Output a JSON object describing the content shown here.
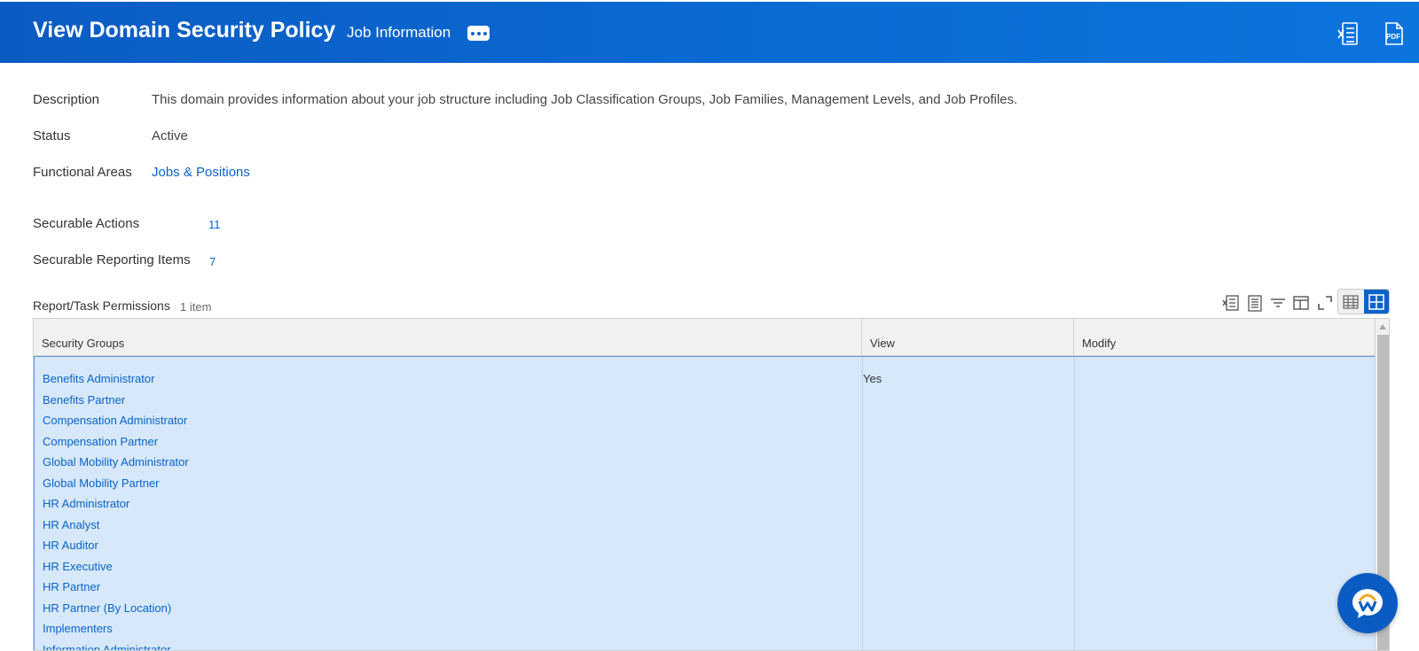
{
  "header": {
    "title": "View Domain Security Policy",
    "subtitle": "Job Information",
    "more_icon": "ellipsis-icon",
    "export_excel_icon": "excel-export-icon",
    "export_pdf_label": "PDF"
  },
  "fields": {
    "description_label": "Description",
    "description_value": "This domain provides information about your job structure including Job Classification Groups, Job Families, Management Levels, and Job Profiles.",
    "status_label": "Status",
    "status_value": "Active",
    "functional_areas_label": "Functional Areas",
    "functional_areas_value": "Jobs & Positions",
    "securable_actions_label": "Securable Actions",
    "securable_actions_count": "11",
    "securable_reporting_label": "Securable Reporting Items",
    "securable_reporting_count": "7"
  },
  "grid": {
    "title": "Report/Task Permissions",
    "count": "1 item",
    "columns": [
      "Security Groups",
      "View",
      "Modify"
    ],
    "row": {
      "security_groups": [
        "Benefits Administrator",
        "Benefits Partner",
        "Compensation Administrator",
        "Compensation Partner",
        "Global Mobility Administrator",
        "Global Mobility Partner",
        "HR Administrator",
        "HR Analyst",
        "HR Auditor",
        "HR Executive",
        "HR Partner",
        "HR Partner (By Location)",
        "Implementers",
        "Information Administrator"
      ],
      "view": "Yes",
      "modify": ""
    },
    "toolbar_icons": [
      "excel-export-icon",
      "print-icon",
      "filter-icon",
      "columns-icon",
      "fullscreen-icon",
      "table-view-icon",
      "grid-view-icon"
    ]
  },
  "colors": {
    "header_bg": "#0b63c9",
    "link": "#0b63c9",
    "selected_row_bg": "#d6e8fa"
  }
}
